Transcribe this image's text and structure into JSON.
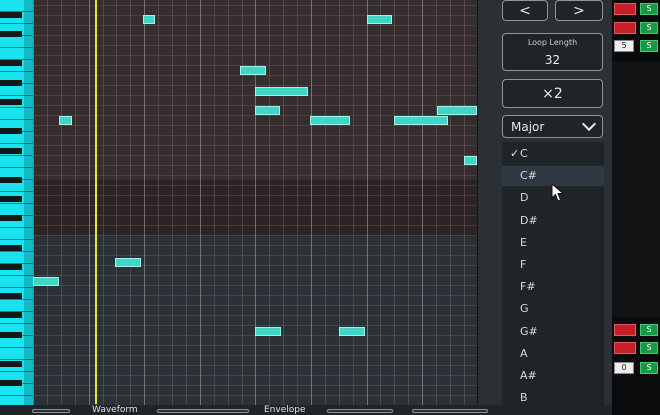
{
  "nav": {
    "prev_label": "<",
    "next_label": ">"
  },
  "loop": {
    "title": "Loop Length",
    "value": "32"
  },
  "multiply_label": "×2",
  "scale": {
    "selected": "Major"
  },
  "key_list": {
    "checkmark": "✓",
    "items": [
      "C",
      "C#",
      "D",
      "D#",
      "E",
      "F",
      "F#",
      "G",
      "G#",
      "A",
      "A#",
      "B"
    ],
    "selected_index": 0,
    "hover_index": 1
  },
  "mixer": {
    "solo_label": "S",
    "value_label": "5",
    "zero_label": "0"
  },
  "bottom_tabs": {
    "waveform": "Waveform",
    "envelope": "Envelope"
  },
  "colors": {
    "note": "#3ed6c7",
    "playhead": "#e4e33a",
    "white_key": "#19e3ef",
    "mute": "#c81e26",
    "solo": "#169a46"
  }
}
